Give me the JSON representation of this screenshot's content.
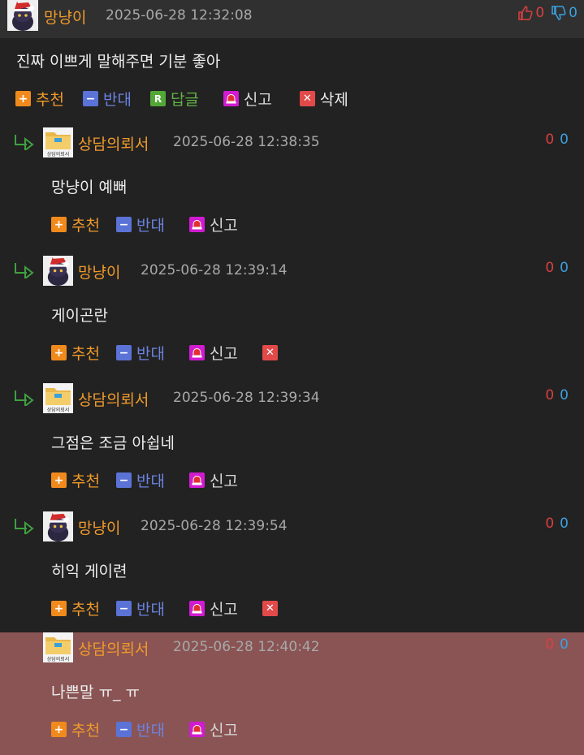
{
  "post": {
    "author": "망냥이",
    "time": "2025-06-28 12:32:08",
    "up": "0",
    "down": "0",
    "text": "진짜 이쁘게 말해주면 기분 좋아",
    "actions": {
      "recommend": "추천",
      "oppose": "반대",
      "reply": "답글",
      "report": "신고",
      "delete": "삭제"
    }
  },
  "labels": {
    "recommend": "추천",
    "oppose": "반대",
    "report": "신고"
  },
  "comments": [
    {
      "author": "상담의뢰서",
      "time": "2025-06-28 12:38:35",
      "up": "0",
      "down": "0",
      "text": "망냥이 예뻐",
      "avatar": "folder",
      "deletable": false
    },
    {
      "author": "망냥이",
      "time": "2025-06-28 12:39:14",
      "up": "0",
      "down": "0",
      "text": "게이곤란",
      "avatar": "cat",
      "deletable": true
    },
    {
      "author": "상담의뢰서",
      "time": "2025-06-28 12:39:34",
      "up": "0",
      "down": "0",
      "text": "그점은 조금 아쉽네",
      "avatar": "folder",
      "deletable": false
    },
    {
      "author": "망냥이",
      "time": "2025-06-28 12:39:54",
      "up": "0",
      "down": "0",
      "text": "히익 게이련",
      "avatar": "cat",
      "deletable": true
    },
    {
      "author": "상담의뢰서",
      "time": "2025-06-28 12:40:42",
      "up": "0",
      "down": "0",
      "text": "나쁜말 ㅠ_ ㅠ",
      "avatar": "folder",
      "deletable": false,
      "highlight": true
    }
  ],
  "colors": {
    "accent_orange": "#f09a2a",
    "oppose_blue": "#6b83e0",
    "up_red": "#d94040",
    "down_blue": "#3aa0e0",
    "highlight_bg": "#8a5454"
  },
  "avatar_folder_label": "상담의뢰서"
}
